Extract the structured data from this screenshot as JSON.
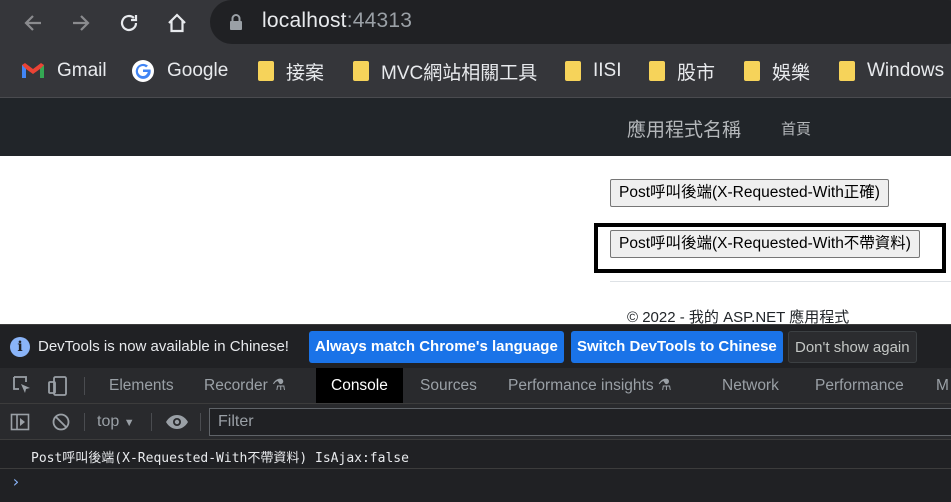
{
  "browser": {
    "url_host": "localhost",
    "url_port": ":44313",
    "bookmarks": [
      {
        "label": "Gmail",
        "icon": "gmail-icon"
      },
      {
        "label": "Google",
        "icon": "google-icon"
      },
      {
        "label": "接案",
        "icon": "folder-icon"
      },
      {
        "label": "MVC網站相關工具",
        "icon": "folder-icon"
      },
      {
        "label": "IISI",
        "icon": "folder-icon"
      },
      {
        "label": "股市",
        "icon": "folder-icon"
      },
      {
        "label": "娛樂",
        "icon": "folder-icon"
      },
      {
        "label": "Windows",
        "icon": "folder-icon"
      }
    ]
  },
  "page": {
    "brand": "應用程式名稱",
    "nav_home": "首頁",
    "button1": "Post呼叫後端(X-Requested-With正確)",
    "button2": "Post呼叫後端(X-Requested-With不帶資料)",
    "footer": "© 2022 - 我的 ASP.NET 應用程式"
  },
  "devtools": {
    "infobar": {
      "message": "DevTools is now available in Chinese!",
      "always_match": "Always match Chrome's language",
      "switch": "Switch DevTools to Chinese",
      "dont_show": "Don't show again"
    },
    "tabs": {
      "elements": "Elements",
      "recorder": "Recorder",
      "console": "Console",
      "sources": "Sources",
      "perf_insights": "Performance insights",
      "network": "Network",
      "performance": "Performance",
      "overflow": "M"
    },
    "console": {
      "context": "top",
      "filter_placeholder": "Filter",
      "log": "Post呼叫後端(X-Requested-With不帶資料) IsAjax:false"
    }
  }
}
